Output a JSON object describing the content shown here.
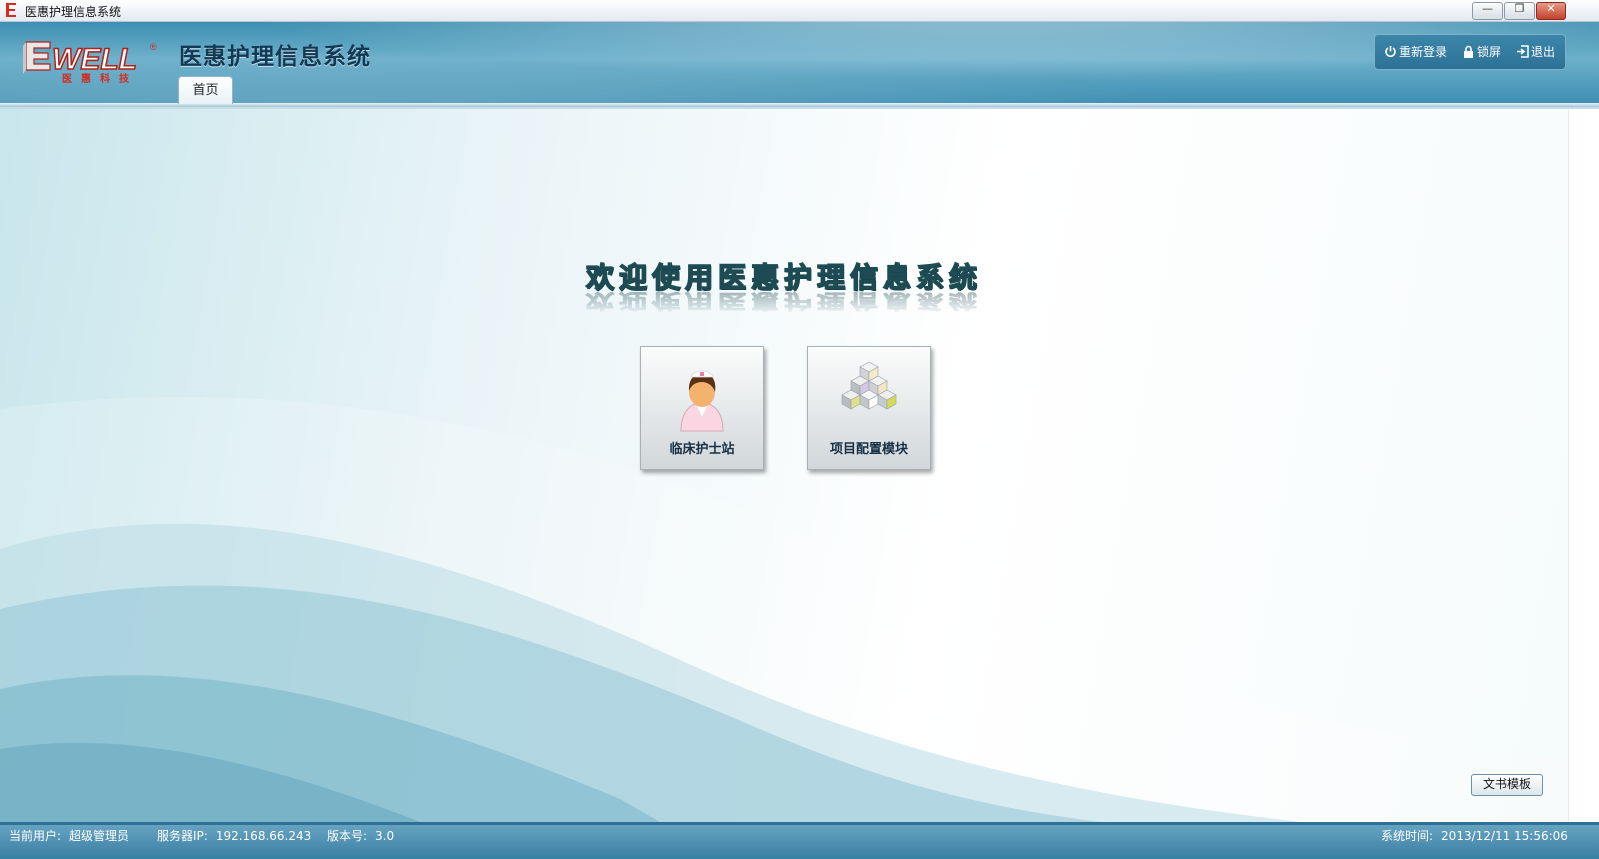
{
  "window": {
    "title": "医惠护理信息系统",
    "controls": {
      "minimize": "—",
      "restore": "❐",
      "close": "✕"
    }
  },
  "header": {
    "logo_text": "WELL",
    "logo_sub": "医惠科技",
    "logo_mark": "®",
    "app_title": "医惠护理信息系统",
    "tabs": [
      {
        "label": "首页"
      }
    ],
    "actions": {
      "relogin": {
        "label": "重新登录",
        "icon": "power-icon"
      },
      "lock": {
        "label": "锁屏",
        "icon": "lock-icon"
      },
      "exit": {
        "label": "退出",
        "icon": "exit-icon"
      }
    }
  },
  "main": {
    "welcome": "欢迎使用医惠护理信息系统",
    "modules": [
      {
        "label": "临床护士站",
        "icon": "nurse-icon"
      },
      {
        "label": "项目配置模块",
        "icon": "cubes-icon"
      }
    ],
    "doc_template_button": "文书模板"
  },
  "status": {
    "user_label": "当前用户:",
    "user_value": "超级管理员",
    "server_label": "服务器IP:",
    "server_value": "192.168.66.243",
    "version_label": "版本号:",
    "version_value": "3.0",
    "time_label": "系统时间:",
    "time_value": "2013/12/11 15:56:06"
  },
  "colors": {
    "header_blue": "#4a9abb",
    "status_blue": "#3a7fa4",
    "logo_red": "#d62b1f"
  }
}
